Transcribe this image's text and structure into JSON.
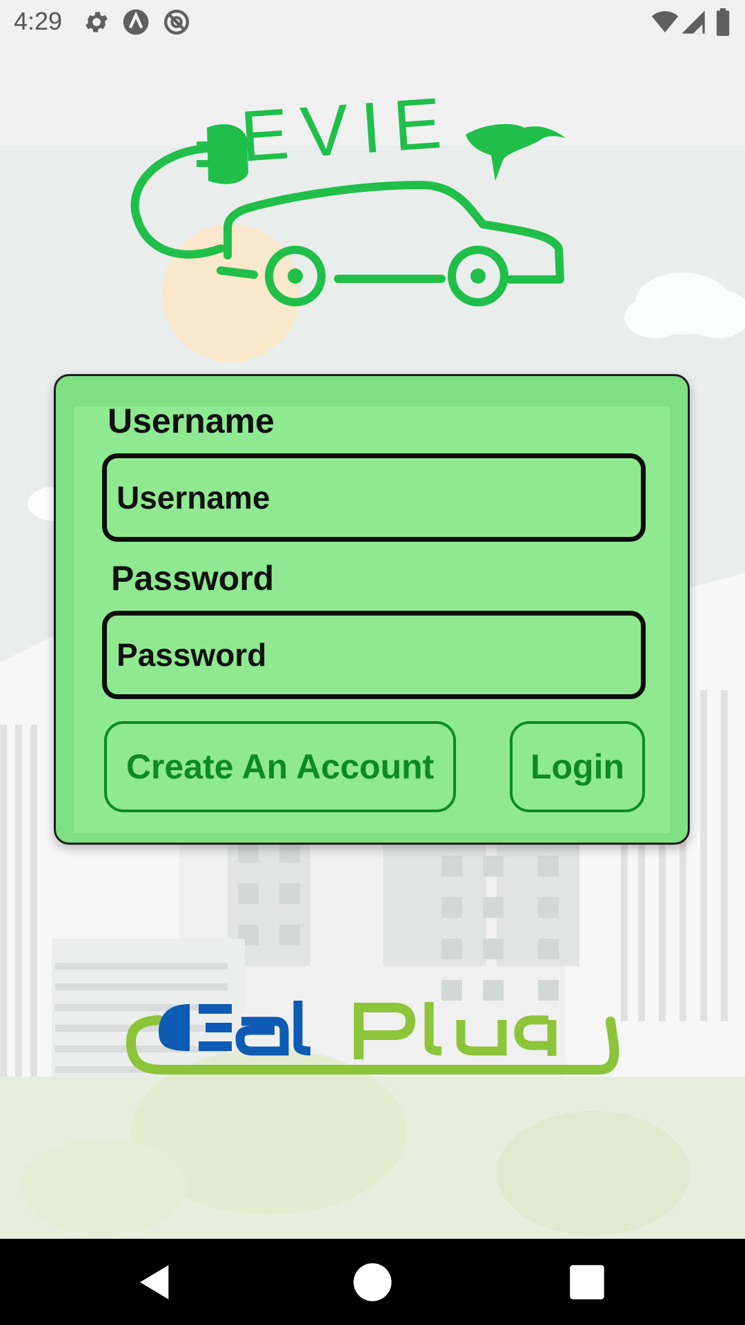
{
  "status_bar": {
    "time": "4:29",
    "icons": [
      "gear-icon",
      "a-circle-icon",
      "no-sim-icon",
      "wifi-icon",
      "signal-icon",
      "battery-icon"
    ]
  },
  "logo": {
    "text": "EVIE",
    "color": "#1fbf4a"
  },
  "login_form": {
    "username_label": "Username",
    "username_placeholder": "Username",
    "password_label": "Password",
    "password_placeholder": "Password",
    "create_account_label": "Create An Account",
    "login_label": "Login",
    "card_color": "#7edf83",
    "button_color": "#0d8a22"
  },
  "footer_logo": {
    "text_part1": "Deal",
    "text_part2": "Plug",
    "color1": "#0d5bb5",
    "color2": "#8cc43a"
  },
  "nav_bar": {
    "buttons": [
      "back-icon",
      "home-icon",
      "recents-icon"
    ]
  }
}
